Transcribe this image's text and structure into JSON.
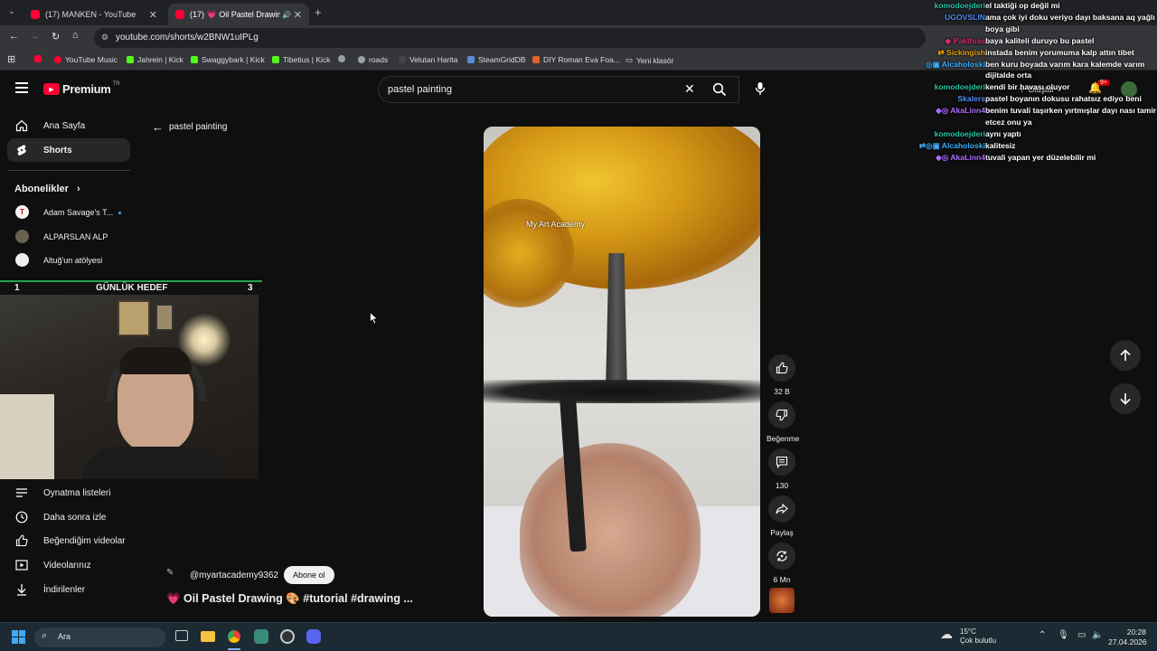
{
  "browser": {
    "tabs": [
      {
        "title": "(17) MANKEN - YouTube",
        "active": false
      },
      {
        "title": "(17) 💗 Oil Pastel Drawing (",
        "active": true
      }
    ],
    "url": "youtube.com/shorts/w2BNW1uIPLg",
    "bookmarks": [
      "YouTube Music",
      "Jahrein | Kick",
      "Swaggybark | Kick",
      "Tibetius | Kick",
      "roads",
      "Velutan Harita",
      "SteamGridDB",
      "DIY Roman Eva Foa...",
      "Yeni klasör"
    ]
  },
  "header": {
    "logo_text": "Premium",
    "logo_region": "TR",
    "search_value": "pastel painting",
    "create_label": "Oluştur",
    "notif_badge": "9+"
  },
  "sidebar": {
    "main": [
      {
        "label": "Ana Sayfa",
        "icon": "home-icon"
      },
      {
        "label": "Shorts",
        "icon": "shorts-icon",
        "active": true
      }
    ],
    "subscriptions_title": "Abonelikler",
    "subscriptions": [
      {
        "name": "Adam Savage's T...",
        "dot": true
      },
      {
        "name": "ALPARSLAN ALP"
      },
      {
        "name": "Altuğ'un atölyesi"
      }
    ],
    "you": [
      {
        "label": "Oynatma listeleri",
        "icon": "playlist-icon"
      },
      {
        "label": "Daha sonra izle",
        "icon": "clock-icon"
      },
      {
        "label": "Beğendiğim videolar",
        "icon": "like-icon"
      },
      {
        "label": "Videolarınız",
        "icon": "video-icon"
      },
      {
        "label": "İndirilenler",
        "icon": "download-icon"
      }
    ]
  },
  "back_label": "pastel painting",
  "stream_overlay": {
    "goal_left": "1",
    "goal_title": "GÜNLÜK HEDEF",
    "goal_right": "3"
  },
  "short": {
    "watermark": "My Art Academy",
    "channel": "@myartacademy9362",
    "subscribe_label": "Abone ol",
    "title": "💗 Oil Pastel Drawing 🎨 #tutorial #drawing ...",
    "actions": {
      "likes": "32 B",
      "dislike_label": "Beğenme",
      "comments": "130",
      "share_label": "Paylaş",
      "remix_label": "6 Mn"
    }
  },
  "chat": [
    {
      "user": "komodoejderi",
      "color": "#26c6a6",
      "badge": "",
      "msg": "el taktiği op değil mi"
    },
    {
      "user": "UGOVSLIN",
      "color": "#4f8ef7",
      "badge": "",
      "msg": "ama çok iyi doku veriyo dayı baksana aq yağlı boya gibi"
    },
    {
      "user": "Pakthias",
      "color": "#d62f6b",
      "badge": "◆",
      "msg": "baya kaliteli duruyo bu pastel"
    },
    {
      "user": "Sickingish",
      "color": "#e8a21a",
      "badge": "⇄",
      "msg": "instada benim yorumuma kalp attın tibet"
    },
    {
      "user": "Alcaholoski",
      "color": "#3bb0ff",
      "badge": "◎▣",
      "msg": "ben kuru boyada varım kara kalemde varım dijitalde orta"
    },
    {
      "user": "komodoejderi",
      "color": "#26c6a6",
      "badge": "",
      "msg": "kendi bir havası oluyor"
    },
    {
      "user": "Skalers",
      "color": "#4f8ef7",
      "badge": "",
      "msg": "pastel boyanın dokusu rahatsız ediyo beni"
    },
    {
      "user": "AkaLinn4",
      "color": "#b06cff",
      "badge": "◆◎",
      "msg": "benim tuvali taşırken yırtmışlar dayı nası tamir etcez onu ya"
    },
    {
      "user": "komodoejderi",
      "color": "#26c6a6",
      "badge": "",
      "msg": "aynı yaptı"
    },
    {
      "user": "Alcaholoski",
      "color": "#3bb0ff",
      "badge": "⇄◎▣",
      "msg": "kalitesiz"
    },
    {
      "user": "AkaLinn4",
      "color": "#b06cff",
      "badge": "◆◎",
      "msg": "tuvali yapan yer düzelebilir mi"
    }
  ],
  "taskbar": {
    "search_placeholder": "Ara",
    "weather_temp": "15°C",
    "weather_desc": "Çok bulutlu",
    "time": "20:28",
    "date": "27.04.2026"
  }
}
